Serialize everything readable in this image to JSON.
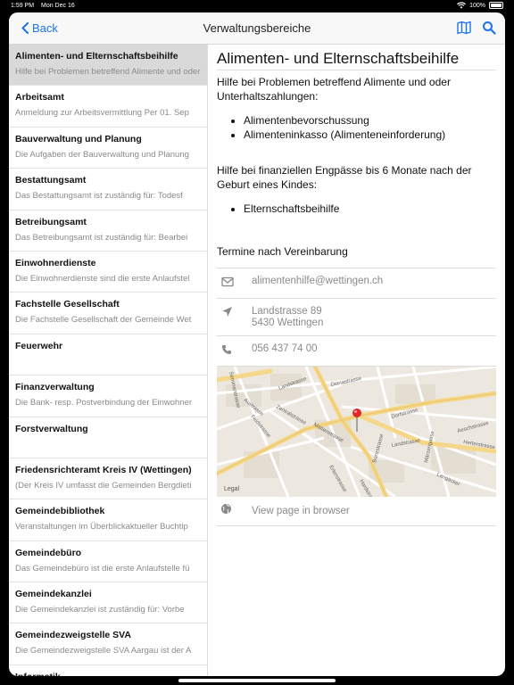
{
  "status": {
    "time": "1:59 PM",
    "date": "Mon Dec 16",
    "battery": "100%"
  },
  "nav": {
    "back_label": "Back",
    "title": "Verwaltungsbereiche"
  },
  "sidebar": {
    "items": [
      {
        "title": "Alimenten- und Elternschaftsbeihilfe",
        "subtitle": "Hilfe bei Problemen betreffend Alimente und oder",
        "selected": true
      },
      {
        "title": "Arbeitsamt",
        "subtitle": "Anmeldung zur Arbeitsvermittlung  Per 01. Sep"
      },
      {
        "title": "Bauverwaltung und Planung",
        "subtitle": "Die Aufgaben der Bauverwaltung und Planung"
      },
      {
        "title": "Bestattungsamt",
        "subtitle": "Das Bestattungsamt ist zuständig für:  Todesf"
      },
      {
        "title": "Betreibungsamt",
        "subtitle": "Das Betreibungsamt ist zuständig für:  Bearbei"
      },
      {
        "title": "Einwohnerdienste",
        "subtitle": "Die Einwohnerdienste sind die erste Anlaufstel"
      },
      {
        "title": "Fachstelle Gesellschaft",
        "subtitle": "Die Fachstelle Gesellschaft der Gemeinde Wet"
      },
      {
        "title": "Feuerwehr",
        "subtitle": ""
      },
      {
        "title": "Finanzverwaltung",
        "subtitle": "Die Bank- resp. Postverbindung der Einwohner"
      },
      {
        "title": "Forstverwaltung",
        "subtitle": ""
      },
      {
        "title": "Friedensrichteramt Kreis IV (Wettingen)",
        "subtitle": "(Der Kreis IV umfasst die Gemeinden Bergdieti"
      },
      {
        "title": "Gemeindebibliothek",
        "subtitle": "Veranstaltungen im Überblickaktueller Buchtip"
      },
      {
        "title": "Gemeindebüro",
        "subtitle": "Das Gemeindebüro ist die erste Anlaufstelle fü"
      },
      {
        "title": "Gemeindekanzlei",
        "subtitle": "Die Gemeindekanzlei ist zuständig für:   Vorbe"
      },
      {
        "title": "Gemeindezweigstelle SVA",
        "subtitle": "Die Gemeindezweigstelle SVA Aargau ist der A"
      },
      {
        "title": "Informatik",
        "subtitle": ""
      }
    ]
  },
  "detail": {
    "title": "Alimenten- und Elternschaftsbeihilfe",
    "p1": "Hilfe bei Problemen betreffend Alimente und oder Unterhaltszahlungen:",
    "list1": [
      "Alimentenbevorschussung",
      "Alimenteninkasso (Alimenteneinforderung)"
    ],
    "p2": "Hilfe bei finanziellen Engpässe bis 6 Monate nach der Geburt eines Kindes:",
    "list2": [
      "Elternschaftsbeihilfe"
    ],
    "p3": "Termine nach Vereinbarung",
    "email": "alimentenhilfe@wettingen.ch",
    "address_line1": "Landstrasse 89",
    "address_line2": "5430 Wettingen",
    "phone": "056 437 74 00",
    "browser_link": "View page in browser"
  },
  "map": {
    "legal": "Legal",
    "streets": {
      "seminarstrasse": "Seminarstrasse",
      "landstrasse1": "Landstrasse",
      "dianastrasse": "Dianastrasse",
      "austrasse": "Austrasse",
      "zentralstrasse": "Zentralstrasse",
      "feldstrasse": "Feldstrasse",
      "mattenstrasse": "Mattenstrasse",
      "dorfstrasse": "Dorfstrasse",
      "aeschstrasse": "Aeschstrasse",
      "herterstrasse": "Herterstrasse",
      "maerzengasse": "Märzengasse",
      "landstrasse2": "Landstrasse",
      "erlenstrasse": "Erlenstrasse",
      "bunzstrasse": "Bunzstrasse",
      "hardstrasse": "Hardstrasse",
      "langacker": "Langäcker"
    }
  },
  "colors": {
    "accent": "#1a73e8",
    "pin": "#e2262a",
    "map_bg": "#ede8df",
    "road": "#f5d78a"
  }
}
